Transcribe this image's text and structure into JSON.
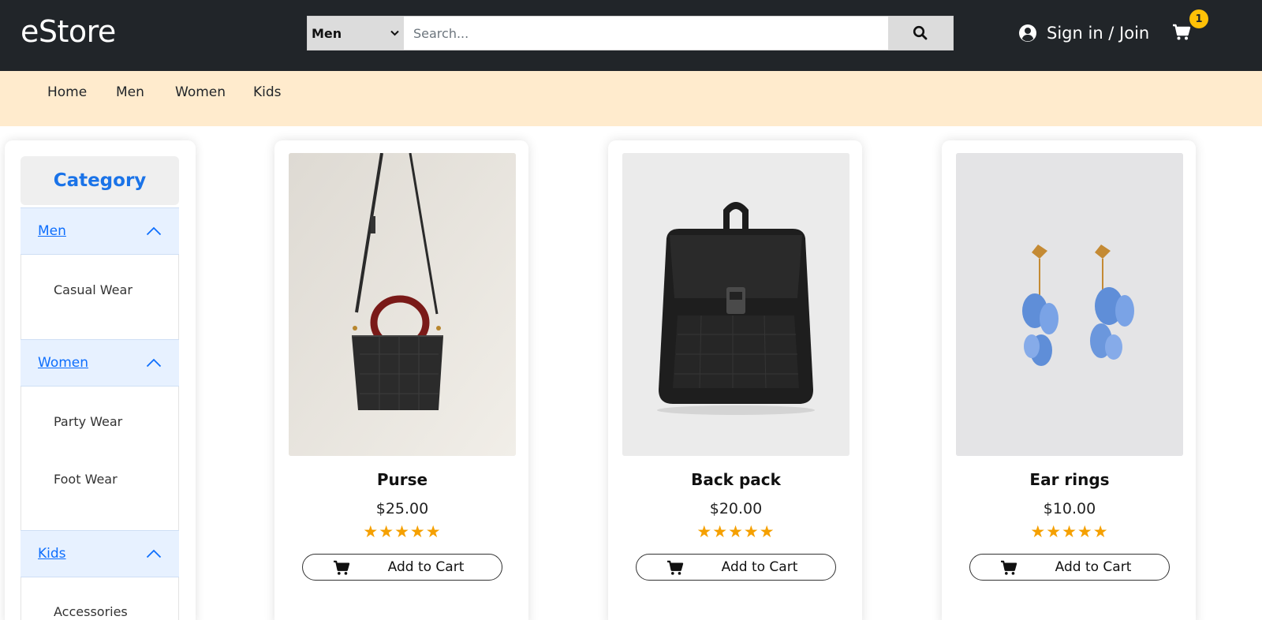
{
  "header": {
    "brand": "eStore",
    "category_select": "Men",
    "search_placeholder": "Search...",
    "signin_label": "Sign in / Join",
    "cart_count": "1"
  },
  "nav": {
    "items": [
      "Home",
      "Men",
      "Women",
      "Kids"
    ]
  },
  "sidebar": {
    "title": "Category",
    "groups": [
      {
        "label": "Men",
        "items": [
          "Casual Wear"
        ]
      },
      {
        "label": "Women",
        "items": [
          "Party Wear",
          "Foot Wear"
        ]
      },
      {
        "label": "Kids",
        "items": [
          "Accessories"
        ]
      }
    ]
  },
  "products": [
    {
      "name": "Purse",
      "price": "$25.00",
      "rating": 5,
      "button": "Add to Cart",
      "image": "black-croc-purse-red-handle"
    },
    {
      "name": "Back pack",
      "price": "$20.00",
      "rating": 5,
      "button": "Add to Cart",
      "image": "black-croc-backpack"
    },
    {
      "name": "Ear rings",
      "price": "$10.00",
      "rating": 5,
      "button": "Add to Cart",
      "image": "blue-flower-earrings"
    }
  ],
  "colors": {
    "header_bg": "#212529",
    "nav_bg": "#ffebcd",
    "accent_blue": "#1a73e8",
    "star": "#f5a000",
    "badge": "#ffc107"
  }
}
